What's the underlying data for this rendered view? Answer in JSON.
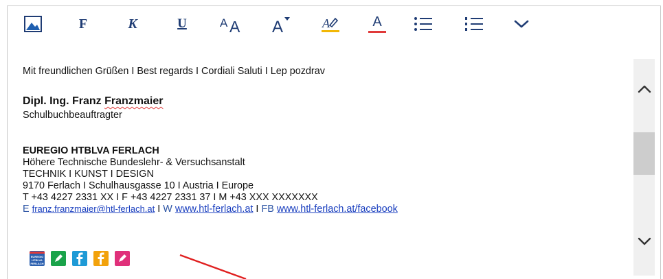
{
  "toolbar": {
    "items": [
      {
        "icon": "image-icon"
      },
      {
        "label": "F"
      },
      {
        "label": "K"
      },
      {
        "label": "U"
      },
      {
        "icon": "font-size-icon"
      },
      {
        "icon": "superscript-font-icon"
      },
      {
        "icon": "highlight-icon"
      },
      {
        "icon": "font-color-icon",
        "color": "#e03a3a"
      },
      {
        "icon": "bulleted-list-icon"
      },
      {
        "icon": "numbered-list-icon"
      },
      {
        "icon": "chevron-down-icon"
      }
    ],
    "bold_label": "F",
    "italic_label": "K",
    "underline_label": "U",
    "font_color_label": "A"
  },
  "signature": {
    "greeting": "Mit freundlichen Grüßen I Best regards I Cordiali Saluti I Lep pozdrav",
    "name_first": "Dipl. Ing. Franz ",
    "name_last": "Franzmaier",
    "role": "Schulbuchbeauftragter",
    "org": "EUREGIO HTBLVA FERLACH",
    "org_sub": "Höhere Technische Bundeslehr- & Versuchsanstalt",
    "motto": "TECHNIK I KUNST I DESIGN",
    "address": "9170 Ferlach I Schulhausgasse 10 I Austria I Europe",
    "phones": "T +43 4227 2331 XX I F +43 4227 2331 37 I M +43 XXX XXXXXXX",
    "email_label": "E ",
    "email": "franz.franzmaier@htl-ferlach.at",
    "sep1": " I ",
    "web_label": "W ",
    "web": "www.htl-ferlach.at",
    "sep2": " I ",
    "fb_label": "FB ",
    "fb": "www.htl-ferlach.at/facebook"
  },
  "social": {
    "logo_text": "EUREGIO HTBLVA FERLACH",
    "colors": [
      "#2b5fae",
      "#1aa34a",
      "#1e9ad6",
      "#f2a20c",
      "#e0307a"
    ]
  },
  "accent": {
    "arrow": "#e02020",
    "toolbar_icon": "#1f3c74"
  }
}
